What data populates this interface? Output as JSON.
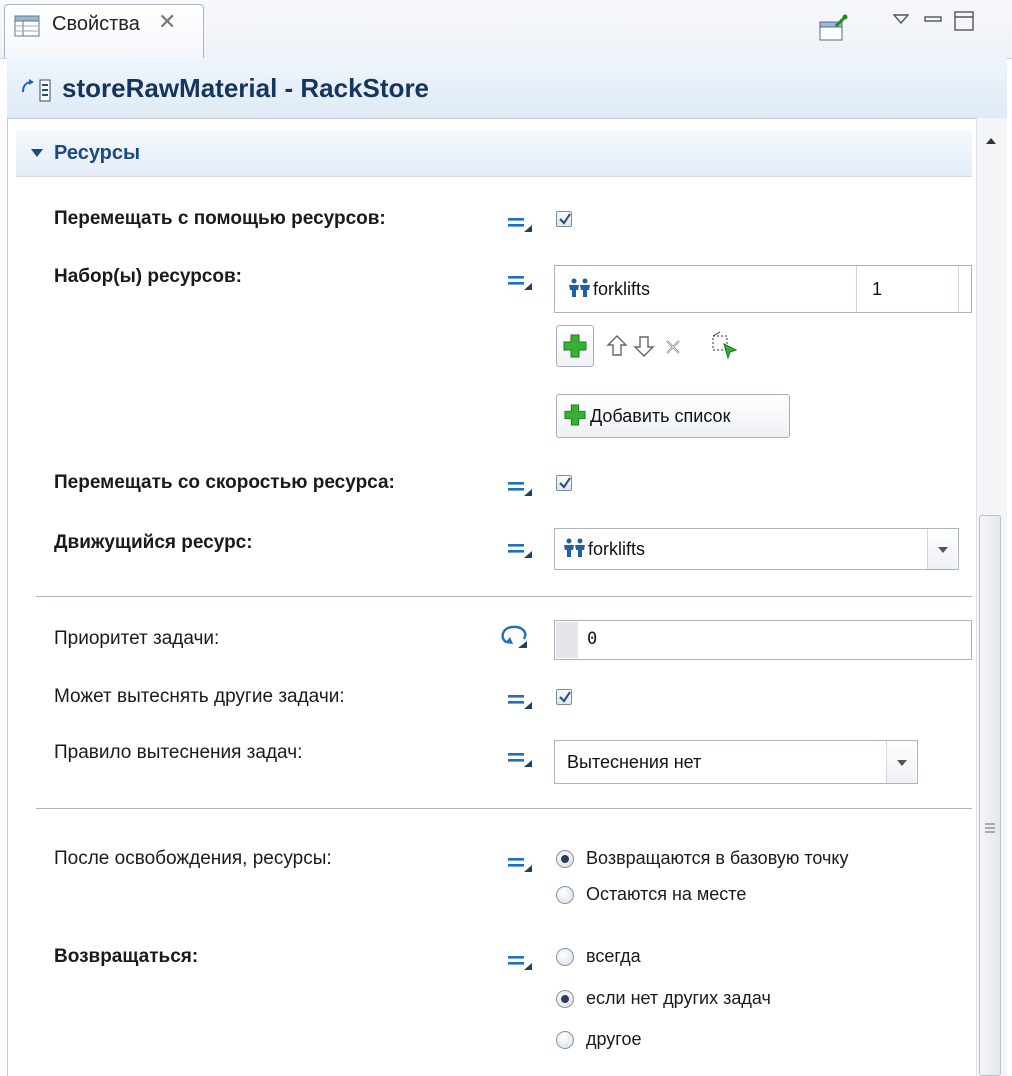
{
  "tab": {
    "icon": "properties-table-icon",
    "label": "Свойства",
    "close_icon": "close-icon"
  },
  "toolbar": {
    "pin_icon": "pin-editor-icon",
    "view_menu_icon": "view-menu-icon",
    "minimize_icon": "minimize-icon",
    "maximize_icon": "maximize-icon"
  },
  "title": {
    "icon": "block-icon",
    "text": "storeRawMaterial - RackStore"
  },
  "section": {
    "icon": "expanded-triangle-icon",
    "label": "Ресурсы"
  },
  "rows": {
    "move_using_resources": {
      "label": "Перемещать с помощью ресурсов:",
      "checked": true
    },
    "resource_sets": {
      "label": "Набор(ы) ресурсов:",
      "item_icon": "resource-pool-icon",
      "item_name": "forklifts",
      "item_count": "1",
      "add_list_label": "Добавить список",
      "list_toolbar_icons": [
        "add-icon",
        "move-up-icon",
        "move-down-icon",
        "remove-icon",
        "select-icon"
      ]
    },
    "move_at_resource_speed": {
      "label": "Перемещать со скоростью ресурса:",
      "checked": true
    },
    "moving_resource": {
      "label": "Движущийся ресурс:",
      "value": "forklifts",
      "icon": "resource-pool-icon"
    },
    "task_priority": {
      "label": "Приоритет задачи:",
      "value": "0",
      "icon": "dynamic-value-icon"
    },
    "can_preempt": {
      "label": "Может вытеснять другие задачи:",
      "checked": true
    },
    "preemption_policy": {
      "label": "Правило вытеснения задач:",
      "value": "Вытеснения нет"
    },
    "after_release": {
      "label": "После освобождения, ресурсы:",
      "options": [
        "Возвращаются в базовую точку",
        "Остаются на месте"
      ],
      "selected": "Возвращаются в базовую точку"
    },
    "return": {
      "label": "Возвращаться:",
      "options": [
        "всегда",
        "если нет других задач",
        "другое"
      ],
      "selected": "если нет других задач"
    }
  },
  "value_editor_icon": "static-value-icon",
  "colors": {
    "section_text": "#1a4b80",
    "title_text": "#16355c",
    "accent_green": "#2e9e2e"
  }
}
